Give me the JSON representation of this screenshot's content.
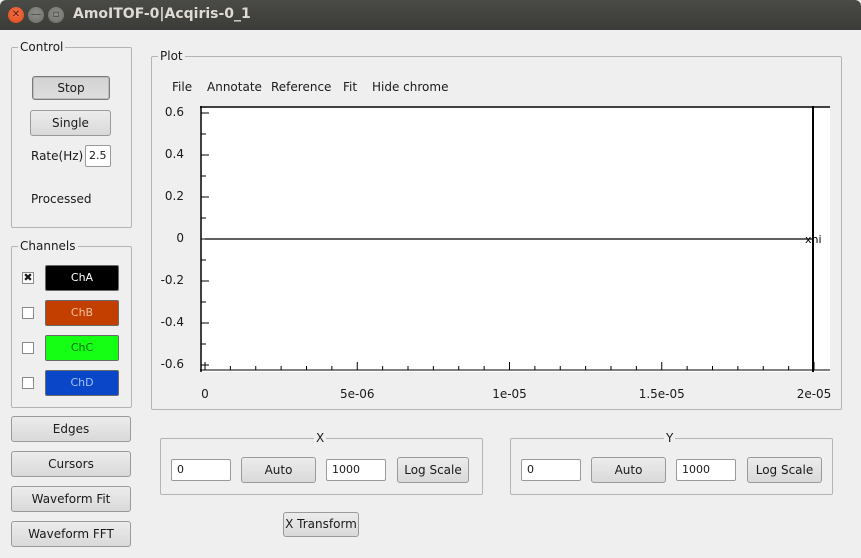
{
  "window": {
    "title": "AmoITOF-0|Acqiris-0_1"
  },
  "control": {
    "title": "Control",
    "stop_label": "Stop",
    "single_label": "Single",
    "rate_label": "Rate(Hz)",
    "rate_value": "2.5",
    "status": "Processed"
  },
  "channels": {
    "title": "Channels",
    "items": [
      {
        "label": "ChA",
        "checked": true,
        "color": "#000000",
        "text_color": "#ffffff"
      },
      {
        "label": "ChB",
        "checked": false,
        "color": "#c23f00",
        "text_color": "#f0c0a0"
      },
      {
        "label": "ChC",
        "checked": false,
        "color": "#14ff14",
        "text_color": "#0a6a0a"
      },
      {
        "label": "ChD",
        "checked": false,
        "color": "#0a46c8",
        "text_color": "#a8c0ff"
      }
    ]
  },
  "left_buttons": {
    "edges": "Edges",
    "cursors": "Cursors",
    "waveform_fit": "Waveform Fit",
    "waveform_fft": "Waveform FFT"
  },
  "plot": {
    "title": "Plot",
    "menu": [
      "File",
      "Annotate",
      "Reference",
      "Fit",
      "Hide chrome"
    ],
    "y_ticks": [
      "0.6",
      "0.4",
      "0.2",
      "0",
      "-0.2",
      "-0.4",
      "-0.6"
    ],
    "x_ticks": [
      "0",
      "5e-06",
      "1e-05",
      "1.5e-05",
      "2e-05"
    ],
    "cursor_label": "xhi"
  },
  "x_axis": {
    "title": "X",
    "min": "0",
    "auto_label": "Auto",
    "max": "1000",
    "log_label": "Log Scale"
  },
  "y_axis": {
    "title": "Y",
    "min": "0",
    "auto_label": "Auto",
    "max": "1000",
    "log_label": "Log Scale"
  },
  "x_transform_label": "X Transform"
}
